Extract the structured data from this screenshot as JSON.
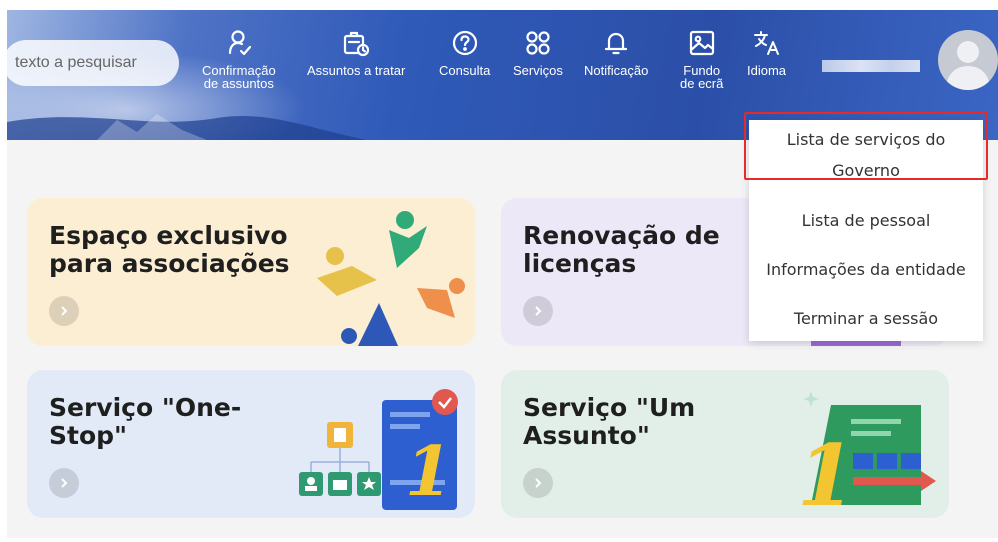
{
  "search": {
    "placeholder": "texto a pesquisar"
  },
  "nav": [
    {
      "label": "Confirmação\nde assuntos",
      "icon": "person-check-icon"
    },
    {
      "label": "Assuntos a tratar",
      "icon": "briefcase-clock-icon"
    },
    {
      "label": "Consulta",
      "icon": "question-icon"
    },
    {
      "label": "Serviços",
      "icon": "apps-grid-icon"
    },
    {
      "label": "Notificação",
      "icon": "bell-icon"
    },
    {
      "label": "Fundo\nde ecrã",
      "icon": "image-icon"
    },
    {
      "label": "Idioma",
      "icon": "translate-icon"
    }
  ],
  "cards": [
    {
      "title": "Espaço exclusivo\npara associações"
    },
    {
      "title": "Renovação de\nlicenças"
    },
    {
      "title": "Serviço \"One-\nStop\""
    },
    {
      "title": "Serviço \"Um\nAssunto\""
    }
  ],
  "dropdown": {
    "items": [
      "Lista de serviços do\nGoverno",
      "Lista de pessoal",
      "Informações da entidade",
      "Terminar a sessão"
    ]
  },
  "illustrations": {
    "stop_number": "1",
    "assunto_number": "1"
  },
  "colors": {
    "header": "#2f5ab8",
    "card_yellow": "#fbeed2",
    "card_purple": "#ede8f7",
    "card_blue": "#e2eaf8",
    "card_green": "#e2efe8",
    "highlight": "#e62a2a"
  }
}
